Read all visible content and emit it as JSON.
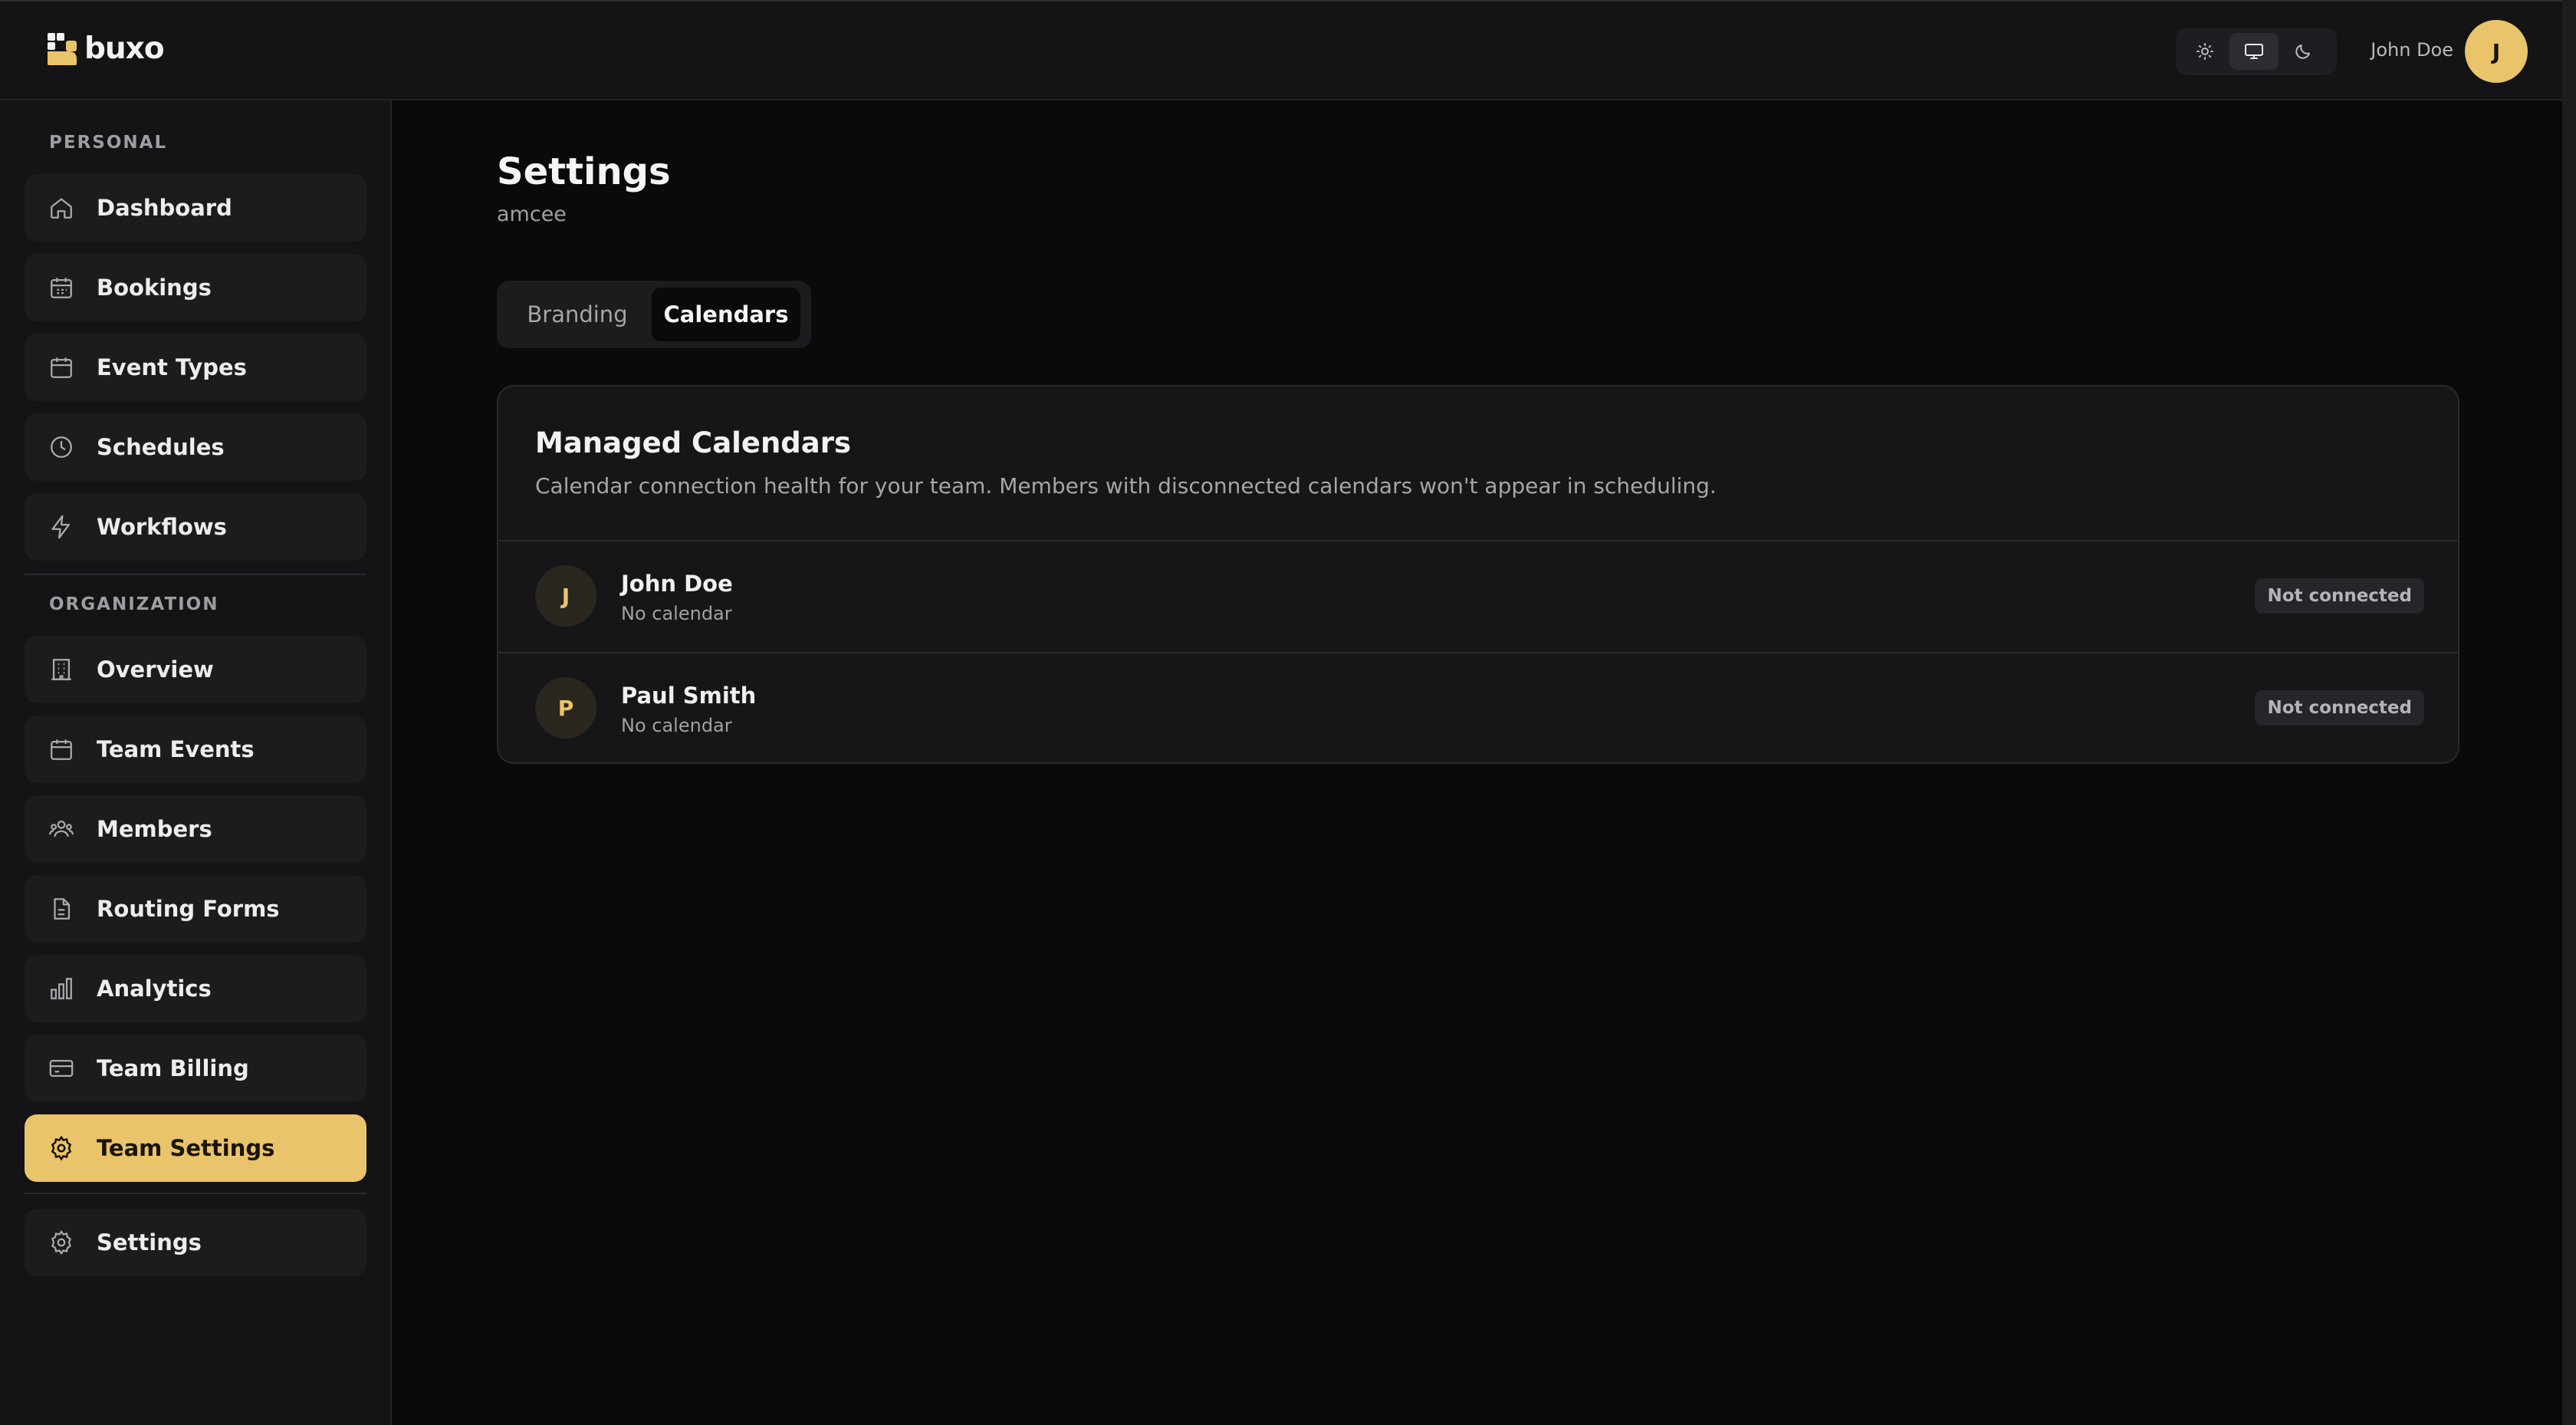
{
  "app": {
    "name": "buxo"
  },
  "topbar": {
    "theme_options": [
      "light-mode",
      "system-mode",
      "dark-mode"
    ],
    "active_theme": "system-mode",
    "user_name": "John Doe",
    "user_initial": "J"
  },
  "sidebar": {
    "personal_label": "PERSONAL",
    "personal_items": [
      {
        "label": "Dashboard",
        "icon": "home-icon"
      },
      {
        "label": "Bookings",
        "icon": "calendar-grid-icon"
      },
      {
        "label": "Event Types",
        "icon": "calendar-icon"
      },
      {
        "label": "Schedules",
        "icon": "clock-icon"
      },
      {
        "label": "Workflows",
        "icon": "lightning-icon"
      }
    ],
    "organization_label": "ORGANIZATION",
    "organization_items": [
      {
        "label": "Overview",
        "icon": "building-icon"
      },
      {
        "label": "Team Events",
        "icon": "calendar-icon"
      },
      {
        "label": "Members",
        "icon": "users-icon"
      },
      {
        "label": "Routing Forms",
        "icon": "document-icon"
      },
      {
        "label": "Analytics",
        "icon": "bar-chart-icon"
      },
      {
        "label": "Team Billing",
        "icon": "credit-card-icon"
      },
      {
        "label": "Team Settings",
        "icon": "gear-icon",
        "active": true
      }
    ],
    "settings_item": {
      "label": "Settings",
      "icon": "gear-icon"
    }
  },
  "main": {
    "title": "Settings",
    "subtitle": "amcee",
    "tabs": [
      {
        "label": "Branding",
        "active": false
      },
      {
        "label": "Calendars",
        "active": true
      }
    ],
    "card": {
      "title": "Managed Calendars",
      "description": "Calendar connection health for your team. Members with disconnected calendars won't appear in scheduling.",
      "members": [
        {
          "initial": "J",
          "name": "John Doe",
          "calendar": "No calendar",
          "status": "Not connected"
        },
        {
          "initial": "P",
          "name": "Paul Smith",
          "calendar": "No calendar",
          "status": "Not connected"
        }
      ]
    }
  },
  "colors": {
    "accent": "#e9c46a",
    "background": "#0a0a0a",
    "surface": "#141416"
  }
}
